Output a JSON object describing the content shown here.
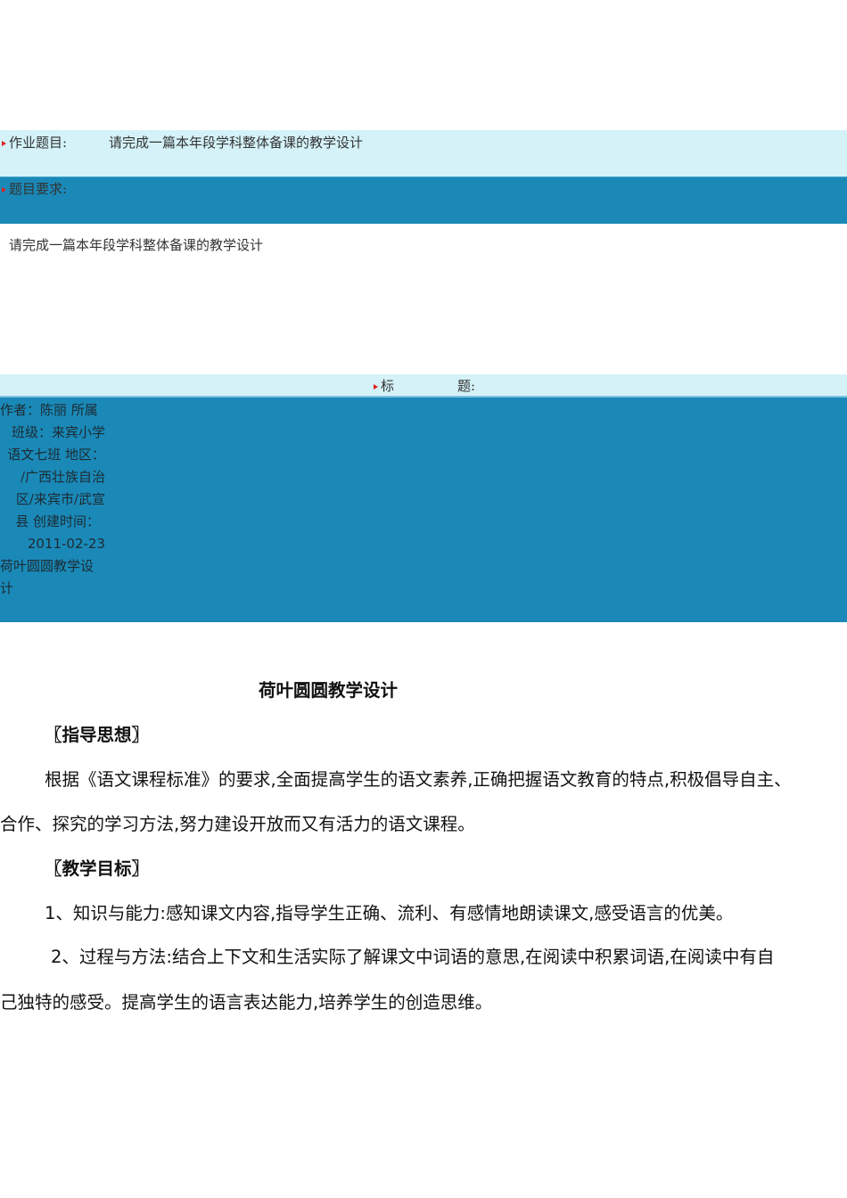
{
  "assignment": {
    "title_label": "作业题目:",
    "title_value": "请完成一篇本年段学科整体备课的教学设计",
    "requirements_label": "题目要求:",
    "requirements_text": "请完成一篇本年段学科整体备课的教学设计"
  },
  "submission": {
    "heading_label_1": "标",
    "heading_label_2": "题:",
    "meta_lines": [
      "作者：陈丽 所属",
      "班级：来宾小学",
      "语文七班 地区：",
      "/广西壮族自治",
      "区/来宾市/武宣",
      "县 创建时间：",
      "2011-02-23",
      "荷叶圆圆教学设",
      "计"
    ]
  },
  "document": {
    "title": "荷叶圆圆教学设计",
    "section1": "〖指导思想〗",
    "para1_line1": "根据《语文课程标准》的要求,全面提高学生的语文素养,正确把握语文教育的特点,积极倡导自主、",
    "para1_line2": "合作、探究的学习方法,努力建设开放而又有活力的语文课程。",
    "section2": "〖教学目标〗",
    "goal1": "1、知识与能力:感知课文内容,指导学生正确、流利、有感情地朗读课文,感受语言的优美。",
    "goal2_line1": "2、过程与方法:结合上下文和生活实际了解课文中词语的意思,在阅读中积累词语,在阅读中有自",
    "goal2_line2": "己独特的感受。提高学生的语言表达能力,培养学生的创造思维。"
  }
}
